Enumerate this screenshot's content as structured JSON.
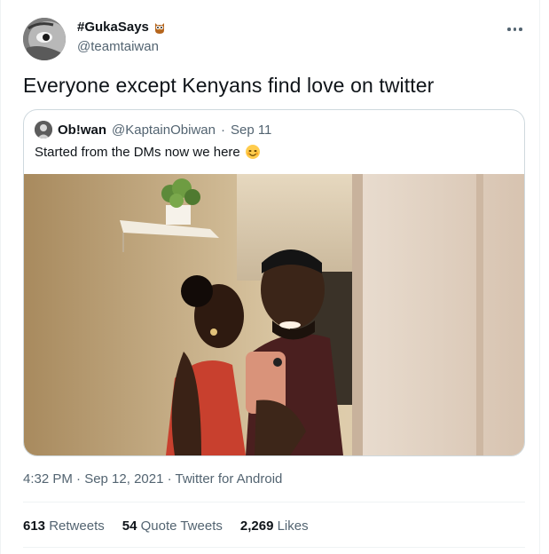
{
  "tweet": {
    "display_name": "#GukaSays",
    "handle": "@teamtaiwan",
    "text": "Everyone except Kenyans find love on twitter",
    "timestamp": "4:32 PM · Sep 12, 2021 · Twitter for Android",
    "name_emoji_icon": "owl-icon",
    "more_icon": "more-options-icon"
  },
  "quoted": {
    "display_name": "Ob!wan",
    "handle": "@KaptainObiwan",
    "separator": "·",
    "date": "Sep 11",
    "text": "Started from the DMs now we here",
    "emoji_icon": "smiling-face-icon"
  },
  "stats": {
    "retweets_count": "613",
    "retweets_label": "Retweets",
    "quotes_count": "54",
    "quotes_label": "Quote Tweets",
    "likes_count": "2,269",
    "likes_label": "Likes"
  },
  "colors": {
    "text_primary": "#0f1419",
    "text_secondary": "#536471",
    "border": "#cfd9de"
  }
}
